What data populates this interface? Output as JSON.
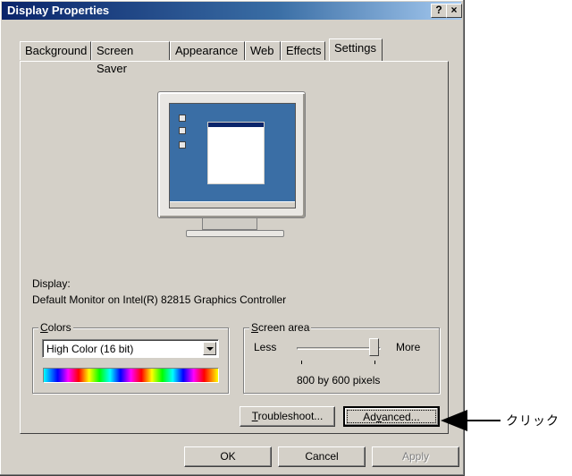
{
  "window": {
    "title": "Display Properties",
    "help_label": "?",
    "close_label": "×"
  },
  "tabs": [
    {
      "label": "Background",
      "active": false
    },
    {
      "label": "Screen Saver",
      "active": false
    },
    {
      "label": "Appearance",
      "active": false
    },
    {
      "label": "Web",
      "active": false
    },
    {
      "label": "Effects",
      "active": false
    },
    {
      "label": "Settings",
      "active": true
    }
  ],
  "display": {
    "label": "Display:",
    "device": "Default Monitor on Intel(R) 82815 Graphics Controller"
  },
  "colors": {
    "group_prefix": "",
    "group_hotkey": "C",
    "group_rest": "olors",
    "selected": "High Color (16 bit)"
  },
  "screen_area": {
    "group_hotkey": "S",
    "group_rest": "creen area",
    "less_label": "Less",
    "more_label": "More",
    "resolution_text": "800 by 600 pixels",
    "slider_fraction": 0.92
  },
  "buttons": {
    "troubleshoot_hotkey": "T",
    "troubleshoot_rest": "roubleshoot...",
    "advanced_pre": "Ad",
    "advanced_hotkey": "v",
    "advanced_rest": "anced...",
    "ok": "OK",
    "cancel": "Cancel",
    "apply": "Apply"
  },
  "annotation": {
    "callout_text": "クリック"
  },
  "colors_theme": {
    "titlebar_start": "#0a246a",
    "titlebar_end": "#a6caf0",
    "face": "#d4d0c8",
    "desktop": "#3a6ea5"
  }
}
